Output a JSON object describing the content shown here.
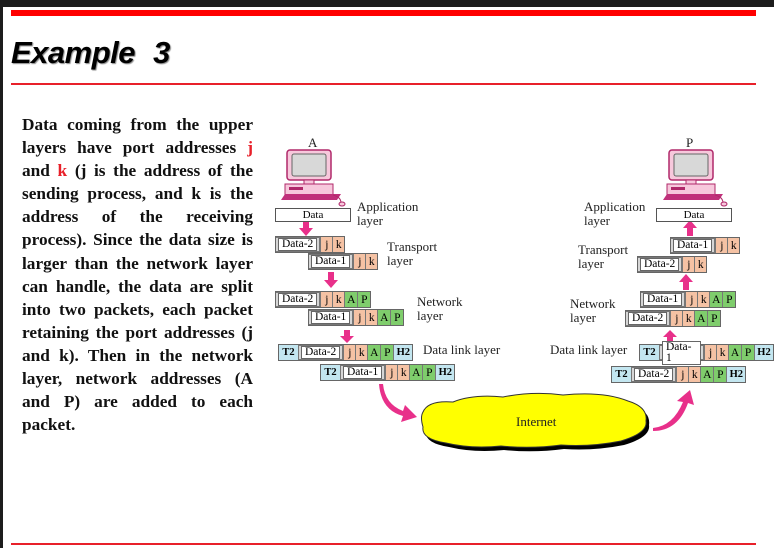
{
  "slide": {
    "title": "Example 3",
    "paragraph": [
      {
        "text": "Data coming from the upper layers have port addresses ",
        "red": false
      },
      {
        "text": "j",
        "red": true
      },
      {
        "text": " and ",
        "red": false
      },
      {
        "text": "k",
        "red": true
      },
      {
        "text": " (j is the address of the sending process, and k is the address of the receiving process). Since the data size is larger than the network layer can handle, the data are split into two packets, each packet retaining the port addresses (j and k). Then in the network layer, network addresses (A and P) are added to each packet.",
        "red": false
      }
    ],
    "accent_color": "#ff0000"
  },
  "diagram": {
    "sender": {
      "host": "A",
      "data": "Data",
      "labels": {
        "application": "Application layer",
        "transport": "Transport layer",
        "network": "Network layer",
        "datalink": "Data link layer"
      },
      "transport": [
        [
          "Data-2",
          "j",
          "k"
        ],
        [
          "Data-1",
          "j",
          "k"
        ]
      ],
      "network": [
        [
          "Data-2",
          "j",
          "k",
          "A",
          "P"
        ],
        [
          "Data-1",
          "j",
          "k",
          "A",
          "P"
        ]
      ],
      "datalink": [
        [
          "T2",
          "Data-2",
          "j",
          "k",
          "A",
          "P",
          "H2"
        ],
        [
          "T2",
          "Data-1",
          "j",
          "k",
          "A",
          "P",
          "H2"
        ]
      ]
    },
    "receiver": {
      "host": "P",
      "data": "Data",
      "labels": {
        "application": "Application layer",
        "transport": "Transport layer",
        "network": "Network layer",
        "datalink": "Data link layer"
      },
      "transport": [
        [
          "Data-1",
          "j",
          "k"
        ],
        [
          "Data-2",
          "j",
          "k"
        ]
      ],
      "network": [
        [
          "Data-1",
          "j",
          "k",
          "A",
          "P"
        ],
        [
          "Data-2",
          "j",
          "k",
          "A",
          "P"
        ]
      ],
      "datalink": [
        [
          "T2",
          "Data-1",
          "j",
          "k",
          "A",
          "P",
          "H2"
        ],
        [
          "T2",
          "Data-2",
          "j",
          "k",
          "A",
          "P",
          "H2"
        ]
      ]
    },
    "cloud": "Internet",
    "colors": {
      "port": "#f5c2a4",
      "network_address": "#7fcd6c",
      "link_header": "#c3e6f0",
      "arrow": "#e8308a",
      "cloud": "#ffff00"
    }
  }
}
